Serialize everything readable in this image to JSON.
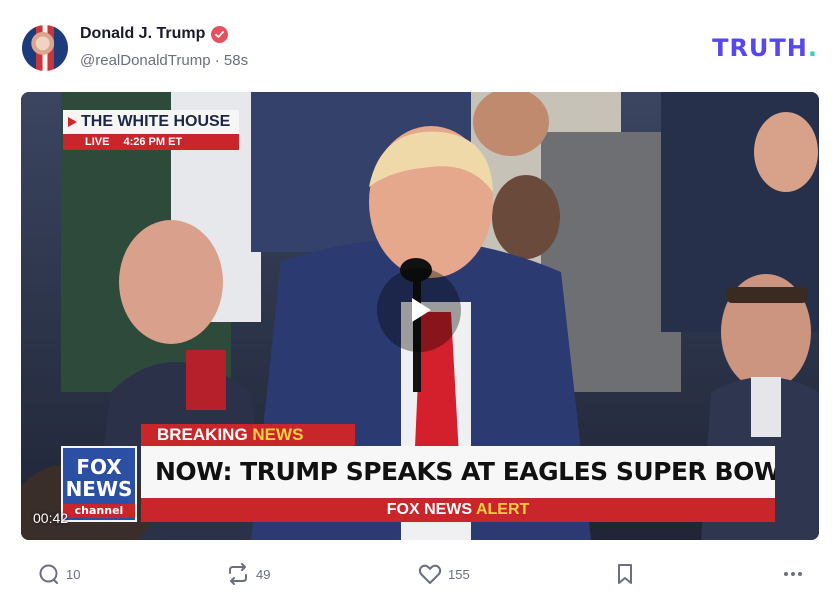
{
  "post": {
    "author": {
      "display_name": "Donald J. Trump",
      "handle": "@realDonaldTrump",
      "separator": "·",
      "age": "58s",
      "verified_color": "#e7505f"
    },
    "brand": {
      "name": "TRUTH",
      "dot": ".",
      "color": "#5448ee",
      "dot_color": "#2fd4c4"
    },
    "video": {
      "timestamp": "00:42",
      "overlay": {
        "corner_title": "THE WHITE HOUSE",
        "corner_live": "LIVE",
        "corner_time": "4:26 PM ET",
        "breaking_word1": "BREAKING",
        "breaking_word2": "NEWS",
        "headline": "NOW: TRUMP SPEAKS AT EAGLES SUPER BOWL CELEBRATION",
        "alert_word1": "FOX NEWS",
        "alert_word2": "ALERT",
        "logo_line1": "FOX",
        "logo_line2": "NEWS",
        "logo_line3": "channel"
      }
    },
    "actions": {
      "replies": "10",
      "retruths": "49",
      "likes": "155"
    }
  }
}
